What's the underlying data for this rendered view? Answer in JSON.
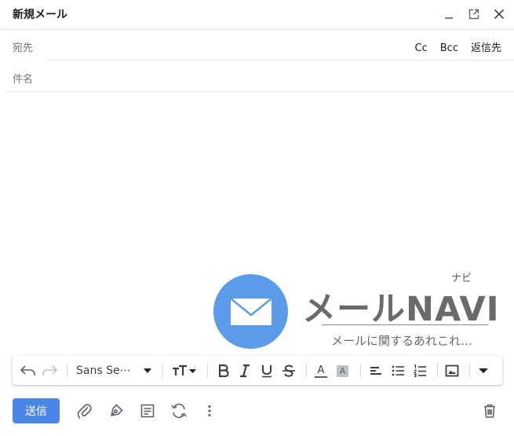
{
  "window": {
    "title": "新規メール"
  },
  "to": {
    "label": "宛先",
    "value": "",
    "cc": "Cc",
    "bcc": "Bcc",
    "reply_to": "返信先"
  },
  "subject": {
    "label": "件名",
    "value": ""
  },
  "body": {
    "text": ""
  },
  "logo": {
    "kana": "ナビ",
    "name": "メールNAVI",
    "tagline": "メールに関するあれこれ…",
    "circle_color": "#5b9bea"
  },
  "toolbar": {
    "font": "Sans Se⋯",
    "text_color_letter": "A",
    "highlight_letter": "A"
  },
  "actions": {
    "send": "送信"
  },
  "colors": {
    "accent": "#4a86e8",
    "icon": "#5f6368"
  }
}
